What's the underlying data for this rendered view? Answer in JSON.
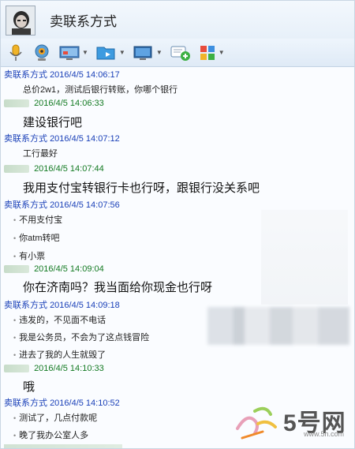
{
  "window": {
    "contact_name": "卖联系方式"
  },
  "toolbar": {
    "buttons": [
      {
        "icon": "microphone-icon",
        "has_menu": false
      },
      {
        "icon": "webcam-icon",
        "has_menu": false
      },
      {
        "icon": "screen-share-icon",
        "has_menu": true
      },
      {
        "icon": "send-file-icon",
        "has_menu": true
      },
      {
        "icon": "remote-desktop-icon",
        "has_menu": true
      },
      {
        "icon": "add-chat-icon",
        "has_menu": false
      },
      {
        "icon": "apps-icon",
        "has_menu": true
      }
    ]
  },
  "messages": [
    {
      "sender": "卖联系方式",
      "time": "2016/4/5 14:06:17",
      "lines": [
        "总价2w1，测试后银行转账，你哪个银行"
      ]
    },
    {
      "sender": "",
      "time": "2016/4/5 14:06:33",
      "lines": [
        "建设银行吧"
      ]
    },
    {
      "sender": "卖联系方式",
      "time": "2016/4/5 14:07:12",
      "lines": [
        "工行最好"
      ]
    },
    {
      "sender": "",
      "time": "2016/4/5 14:07:44",
      "lines": [
        "我用支付宝转银行卡也行呀，跟银行没关系吧"
      ]
    },
    {
      "sender": "卖联系方式",
      "time": "2016/4/5 14:07:56",
      "lines": [
        "不用支付宝",
        "你atm转吧",
        "有小票"
      ]
    },
    {
      "sender": "",
      "time": "2016/4/5 14:09:04",
      "lines": [
        "你在济南吗？我当面给你现金也行呀"
      ]
    },
    {
      "sender": "卖联系方式",
      "time": "2016/4/5 14:09:18",
      "lines": [
        "违发的，不见面不电话",
        "我是公务员，不会为了这点钱冒险",
        "进去了我的人生就毁了"
      ]
    },
    {
      "sender": "",
      "time": "2016/4/5 14:10:33",
      "lines": [
        "哦"
      ]
    },
    {
      "sender": "卖联系方式",
      "time": "2016/4/5 14:10:52",
      "lines": [
        "测试了，几点付款呢",
        "晚了我办公室人多"
      ]
    }
  ],
  "watermark": {
    "number_text": "5号网",
    "url": "www.5h.com"
  },
  "colors": {
    "seller_name": "#1a40b8",
    "buyer_name": "#137a22"
  }
}
